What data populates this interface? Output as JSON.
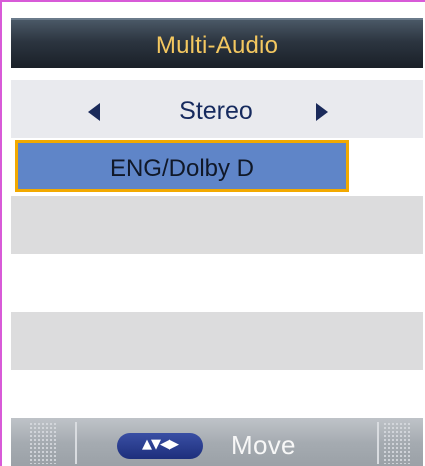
{
  "header": {
    "title": "Multi-Audio"
  },
  "selector": {
    "value": "Stereo",
    "left_icon": "triangle-left-icon",
    "right_icon": "triangle-right-icon"
  },
  "audio_list": {
    "items": [
      {
        "label": "ENG/Dolby D",
        "selected": true
      },
      {
        "label": ""
      },
      {
        "label": ""
      },
      {
        "label": ""
      },
      {
        "label": ""
      }
    ]
  },
  "footer": {
    "nav_icon": "directional-arrows-icon",
    "nav_symbols": "▲▼◀▶",
    "move_label": "Move"
  },
  "colors": {
    "accent": "#f4c860",
    "selection": "#5f85c8",
    "selection_border": "#f2a900",
    "text_dark": "#162a5e"
  }
}
